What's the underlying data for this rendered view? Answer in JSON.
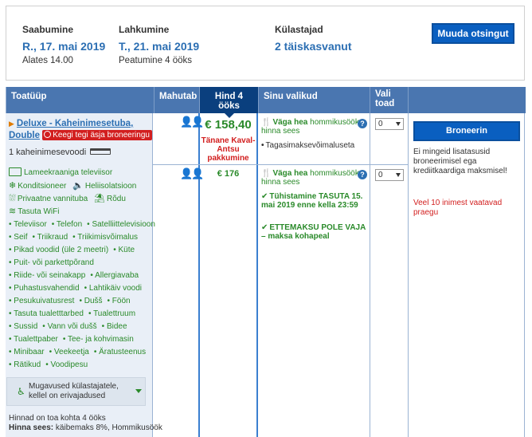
{
  "summary": {
    "arrival_label": "Saabumine",
    "arrival_date": "R., 17. mai 2019",
    "arrival_sub": "Alates 14.00",
    "departure_label": "Lahkumine",
    "departure_date": "T., 21. mai 2019",
    "departure_sub": "Peatumine 4 ööks",
    "guests_label": "Külastajad",
    "guests_value": "2 täiskasvanut",
    "change_button": "Muuda otsingut"
  },
  "table_headers": {
    "room_type": "Toatüüp",
    "sleeps": "Mahutab",
    "price": "Hind 4 ööks",
    "options": "Sinu valikud",
    "select_rooms": "Vali toad"
  },
  "room": {
    "name": "Deluxe - Kaheinimesetuba, Double",
    "recent_badge": "Keegi tegi äsja broneeringu",
    "bed": "1 kaheinimesevoodi",
    "facilities": {
      "tv": "Lameekraaniga televiisor",
      "ac": "Konditsioneer",
      "soundproof": "Heliisolatsioon",
      "bathroom": "Privaatne vannituba",
      "balcony": "Rõdu",
      "wifi": "Tasuta WiFi"
    },
    "amenities": [
      [
        "Televiisor",
        "Telefon",
        "Satelliittelevisioon"
      ],
      [
        "Seif",
        "Triikraud",
        "Triikimisvõimalus"
      ],
      [
        "Pikad voodid (üle 2 meetri)",
        "Küte"
      ],
      [
        "Puit- või parkettpõrand"
      ],
      [
        "Riide- või seinakapp",
        "Allergiavaba"
      ],
      [
        "Puhastusvahendid",
        "Lahtikäiv voodi"
      ],
      [
        "Pesukuivatusrest",
        "Dušš",
        "Föön"
      ],
      [
        "Tasuta tualett­tarbed",
        "Tualettruum"
      ],
      [
        "Sussid",
        "Vann või dušš",
        "Bidee"
      ],
      [
        "Tualettpaber",
        "Tee- ja kohvimasin"
      ],
      [
        "Minibaar",
        "Veekeetja",
        "Äratusteenus"
      ],
      [
        "Rätikud",
        "Voodipesu"
      ]
    ],
    "accessibility": "Mugavused külastajatele, kellel on erivajadused",
    "price_note_line1": "Hinnad on toa kohta 4 ööks",
    "price_note_line2_label": "Hinna sees:",
    "price_note_line2_value": "käibemaks 8%, Hommikusöök"
  },
  "offers": [
    {
      "price": "€ 158,40",
      "price_note": "Tänane Kaval-Antsu pakkumine",
      "food": "Väga hea",
      "food_word": "hommikusöök",
      "food_sub": "hinna sees",
      "conditions": [
        "Tagasimaksevõimaluseta"
      ],
      "select_value": "0"
    },
    {
      "price": "€ 176",
      "food": "Väga hea",
      "food_word": "hommikusöök",
      "food_sub": "hinna sees",
      "conditions": [
        "Tühistamine TASUTA 15. mai 2019 enne kella 23:59",
        "ETTEMAKSU POLE VAJA – maksa kohapeal"
      ],
      "select_value": "0"
    }
  ],
  "booking": {
    "button": "Broneerin",
    "info": "Ei mingeid lisatasusid broneerimisel ega krediitkaardiga maksmisel!",
    "warning": "Veel 10 inimest vaatavad praegu"
  },
  "colors": {
    "accent_blue": "#0a5fc0",
    "header_blue": "#4a76b0",
    "active_header": "#0a3f7e",
    "green": "#2a8a2a",
    "red": "#d21f1f"
  }
}
